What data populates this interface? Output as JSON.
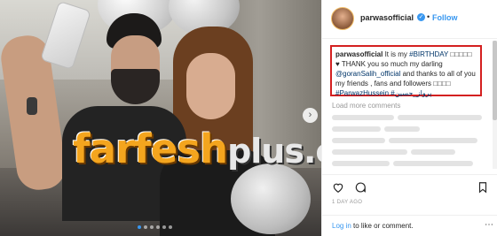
{
  "post": {
    "username": "parwasofficial",
    "separator": "•",
    "follow_label": "Follow"
  },
  "caption": {
    "username": "parwasofficial",
    "text1": " It is my ",
    "hashtag_birthday": "#BIRTHDAY",
    "emojis1": " □□□□□",
    "text2": " ♥ THANK you so much my darling ",
    "mention": "@goranSalih_official",
    "text3": " and thanks to all of you my friends , fans and followers ",
    "emojis2": "□□□□",
    "hashtag_parwaz": "#ParwazHussein",
    "hashtag_arabic": " #پرواز_حسین"
  },
  "comments": {
    "load_more": "Load more comments"
  },
  "timestamp": "1 DAY AGO",
  "footer": {
    "login_link": "Log in",
    "login_rest": " to like or comment.",
    "more_glyph": "⋯"
  },
  "watermark": {
    "part1": "farfesh",
    "part2": "plus.com"
  },
  "icons": {
    "next": "›",
    "verified": "✓"
  },
  "colors": {
    "accent_blue": "#3897f0",
    "highlight_red": "#d42020",
    "watermark_orange": "#f4a51e"
  }
}
